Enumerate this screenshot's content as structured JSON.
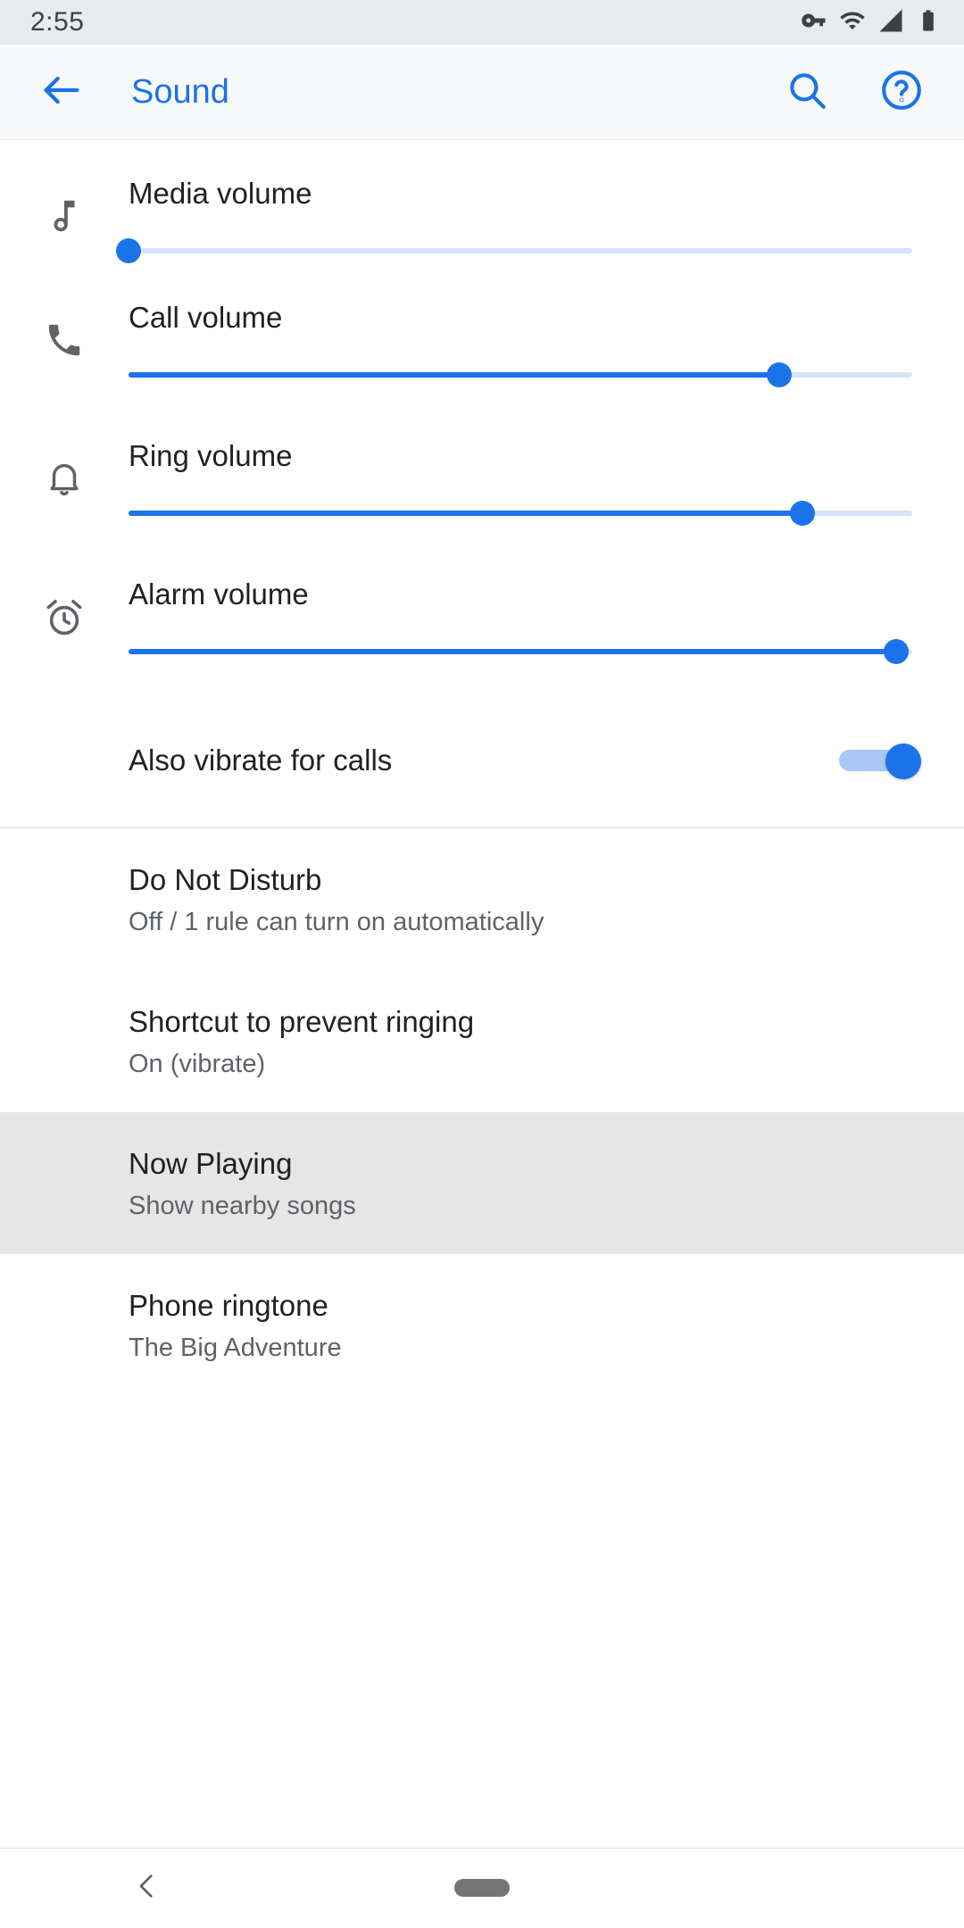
{
  "status_bar": {
    "time": "2:55",
    "icons": [
      "vpn-key-icon",
      "wifi-icon",
      "cell-signal-icon",
      "battery-icon"
    ]
  },
  "app_bar": {
    "back_icon": "arrow-back-icon",
    "title": "Sound",
    "search_icon": "search-icon",
    "help_icon": "help-circle-icon",
    "accent_color": "#1a73e8"
  },
  "volume_sliders": [
    {
      "icon": "music-note-icon",
      "label": "Media volume",
      "value": 0,
      "max": 100
    },
    {
      "icon": "phone-call-icon",
      "label": "Call volume",
      "value": 83,
      "max": 100
    },
    {
      "icon": "bell-icon",
      "label": "Ring volume",
      "value": 86,
      "max": 100
    },
    {
      "icon": "alarm-clock-icon",
      "label": "Alarm volume",
      "value": 100,
      "max": 100
    }
  ],
  "vibrate_toggle": {
    "label": "Also vibrate for calls",
    "state": "on",
    "on_color": "#1a73e8",
    "track_color": "#a8c7f7"
  },
  "settings_list": [
    {
      "title": "Do Not Disturb",
      "subtitle": "Off / 1 rule can turn on automatically",
      "highlighted": false
    },
    {
      "title": "Shortcut to prevent ringing",
      "subtitle": "On (vibrate)",
      "highlighted": false
    },
    {
      "title": "Now Playing",
      "subtitle": "Show nearby songs",
      "highlighted": true
    },
    {
      "title": "Phone ringtone",
      "subtitle": "The Big Adventure",
      "highlighted": false
    }
  ],
  "nav_bar": {
    "back_icon": "nav-back-chevron-icon",
    "home_icon": "home-pill-icon"
  }
}
